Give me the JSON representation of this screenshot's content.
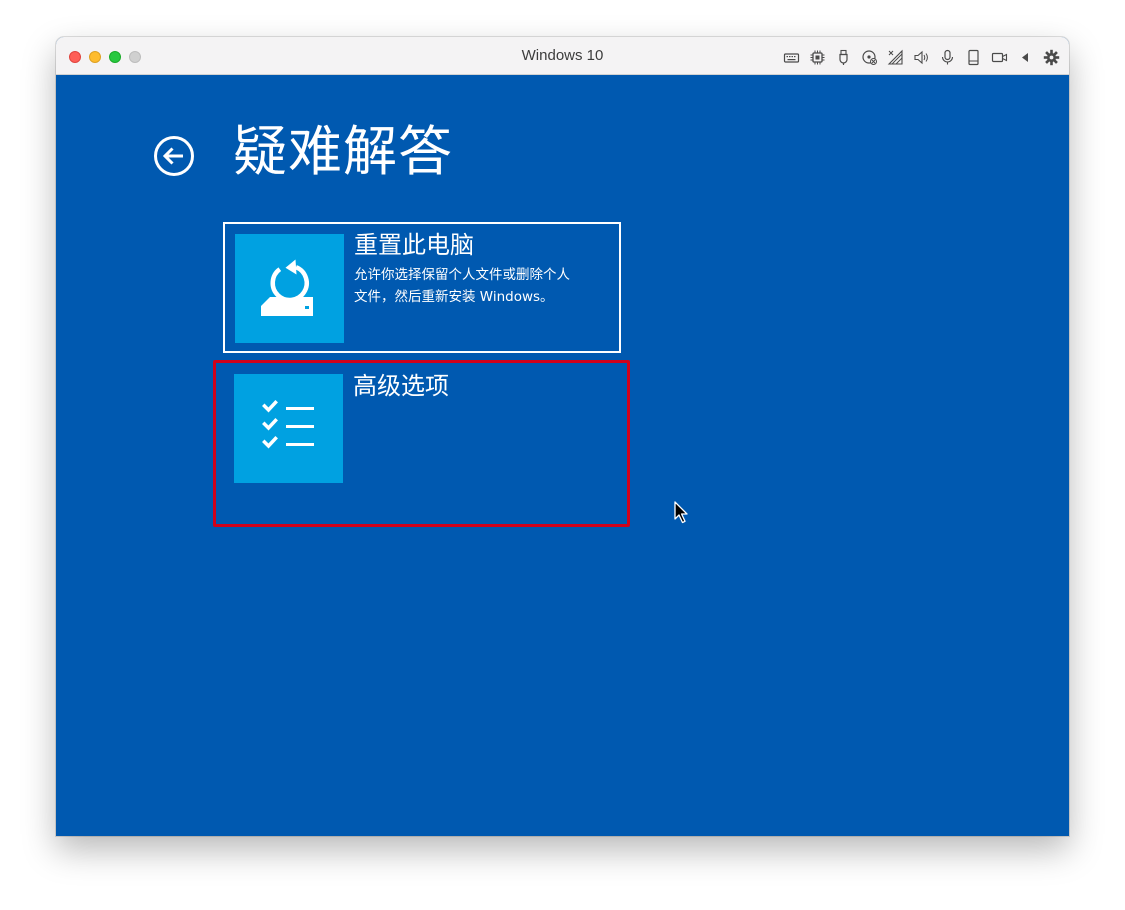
{
  "window": {
    "title": "Windows 10"
  },
  "toolbar_icons": [
    "keyboard-icon",
    "cpu-icon",
    "usb-icon",
    "cd-icon",
    "network-icon",
    "speaker-icon",
    "microphone-icon",
    "disk-icon",
    "camera-icon",
    "collapse-arrow-icon",
    "settings-gear-icon"
  ],
  "screen": {
    "title": "疑难解答",
    "background_color": "#0059b0",
    "tile_icon_color": "#00a1e1",
    "options": [
      {
        "title": "重置此电脑",
        "description_line1": "允许你选择保留个人文件或删除个人",
        "description_line2": "文件，然后重新安装 Windows。",
        "icon": "reset-pc-icon"
      },
      {
        "title": "高级选项",
        "icon": "checklist-icon"
      }
    ]
  },
  "annotation": {
    "highlight_color": "#d0021b"
  }
}
